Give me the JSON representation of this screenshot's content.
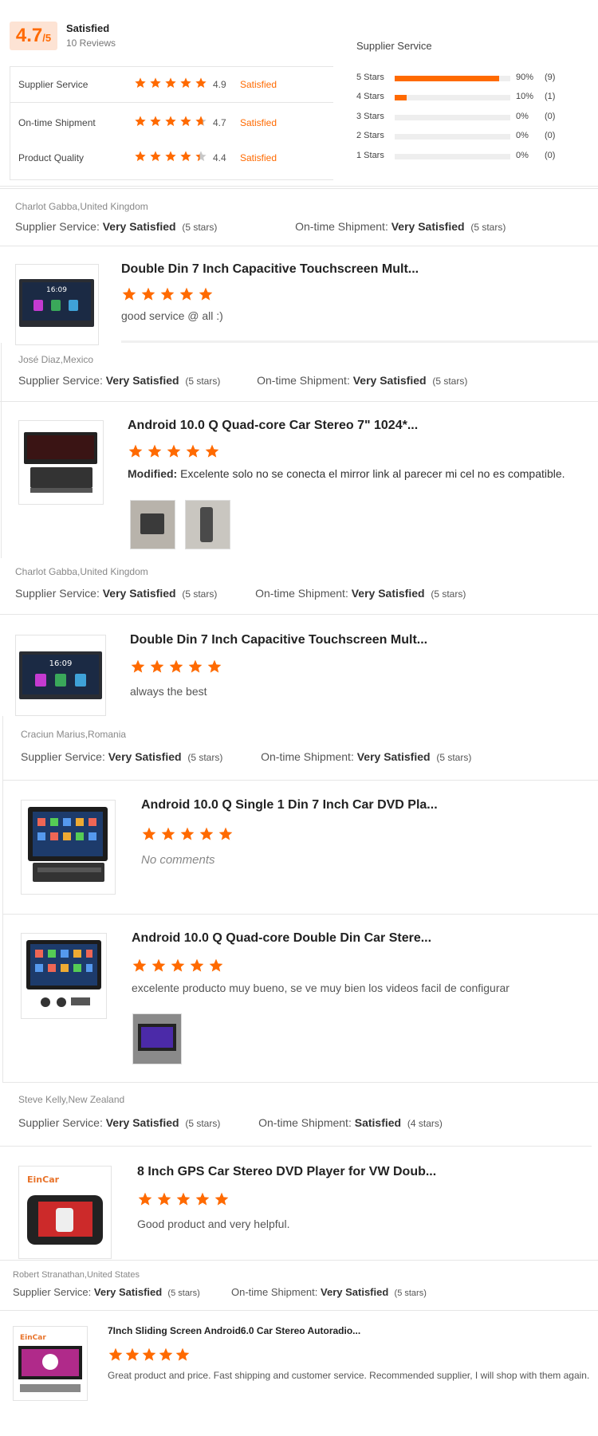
{
  "summary": {
    "score": "4.7",
    "out_of": "/5",
    "level": "Satisfied",
    "reviews": "10 Reviews",
    "ratings": [
      {
        "name": "Supplier Service",
        "value": "4.9",
        "level": "Satisfied",
        "stars": 5
      },
      {
        "name": "On-time Shipment",
        "value": "4.7",
        "level": "Satisfied",
        "stars": 4.7
      },
      {
        "name": "Product Quality",
        "value": "4.4",
        "level": "Satisfied",
        "stars": 4.4
      }
    ],
    "distribution_title": "Supplier Service",
    "distribution": [
      {
        "label": "5 Stars",
        "fraction": 0.9,
        "pct": "90%",
        "count": "(9)"
      },
      {
        "label": "4 Stars",
        "fraction": 0.1,
        "pct": "10%",
        "count": "(1)"
      },
      {
        "label": "3 Stars",
        "fraction": 0,
        "pct": "0%",
        "count": "(0)"
      },
      {
        "label": "2 Stars",
        "fraction": 0,
        "pct": "0%",
        "count": "(0)"
      },
      {
        "label": "1 Stars",
        "fraction": 0,
        "pct": "0%",
        "count": "(0)"
      }
    ]
  },
  "labels": {
    "supplier": "Supplier Service:",
    "shipment": "On-time Shipment:"
  },
  "reviews": [
    {
      "reviewer": "Charlot Gabba,United Kingdom",
      "supplier": "Very Satisfied",
      "supplier_stars": "(5 stars)",
      "shipment": "Very Satisfied",
      "shipment_stars": "(5 stars)",
      "products": [
        {
          "title": "Double Din 7 Inch Capacitive Touchscreen Mult...",
          "stars": 5,
          "prefix": "",
          "comment": "good service @ all :)"
        }
      ]
    },
    {
      "reviewer": "José Diaz,Mexico",
      "supplier": "Very Satisfied",
      "supplier_stars": "(5 stars)",
      "shipment": "Very Satisfied",
      "shipment_stars": "(5 stars)",
      "products": [
        {
          "title": "Android 10.0 Q Quad-core Car Stereo 7\" 1024*...",
          "stars": 5,
          "prefix": "Modified:",
          "comment": "Excelente solo no se conecta el mirror link al parecer mi cel no es compatible."
        }
      ]
    },
    {
      "reviewer": "Charlot Gabba,United Kingdom",
      "supplier": "Very Satisfied",
      "supplier_stars": "(5 stars)",
      "shipment": "Very Satisfied",
      "shipment_stars": "(5 stars)",
      "products": [
        {
          "title": "Double Din 7 Inch Capacitive Touchscreen Mult...",
          "stars": 5,
          "prefix": "",
          "comment": "always the best"
        }
      ]
    },
    {
      "reviewer": "Craciun Marius,Romania",
      "supplier": "Very Satisfied",
      "supplier_stars": "(5 stars)",
      "shipment": "Very Satisfied",
      "shipment_stars": "(5 stars)",
      "products": [
        {
          "title": "Android 10.0 Q Single 1 Din 7 Inch Car DVD Pla...",
          "stars": 5,
          "prefix": "",
          "comment": "No comments"
        },
        {
          "title": "Android 10.0 Q Quad-core Double Din Car Stere...",
          "stars": 5,
          "prefix": "",
          "comment": "excelente producto muy bueno, se ve muy bien los videos facil de configurar"
        }
      ]
    },
    {
      "reviewer": "Steve Kelly,New Zealand",
      "supplier": "Very Satisfied",
      "supplier_stars": "(5 stars)",
      "shipment": "Satisfied",
      "shipment_stars": "(4 stars)",
      "products": [
        {
          "title": "8 Inch GPS Car Stereo DVD Player for VW Doub...",
          "stars": 5,
          "prefix": "",
          "comment": "Good product and very helpful.",
          "thumb_text": "EinCar"
        }
      ]
    },
    {
      "reviewer": "Robert Stranathan,United States",
      "supplier": "Very Satisfied",
      "supplier_stars": "(5 stars)",
      "shipment": "Very Satisfied",
      "shipment_stars": "(5 stars)",
      "products": [
        {
          "title": "7Inch Sliding Screen Android6.0 Car Stereo Autoradio...",
          "stars": 5,
          "prefix": "",
          "comment": "Great product and price. Fast shipping and customer service. Recommended supplier, I will shop with them again.",
          "thumb_text": "EinCar"
        }
      ]
    }
  ],
  "colors": {
    "accent": "#ff6a00",
    "star_empty": "#c8c8c8"
  },
  "screen_clock": "16:09"
}
